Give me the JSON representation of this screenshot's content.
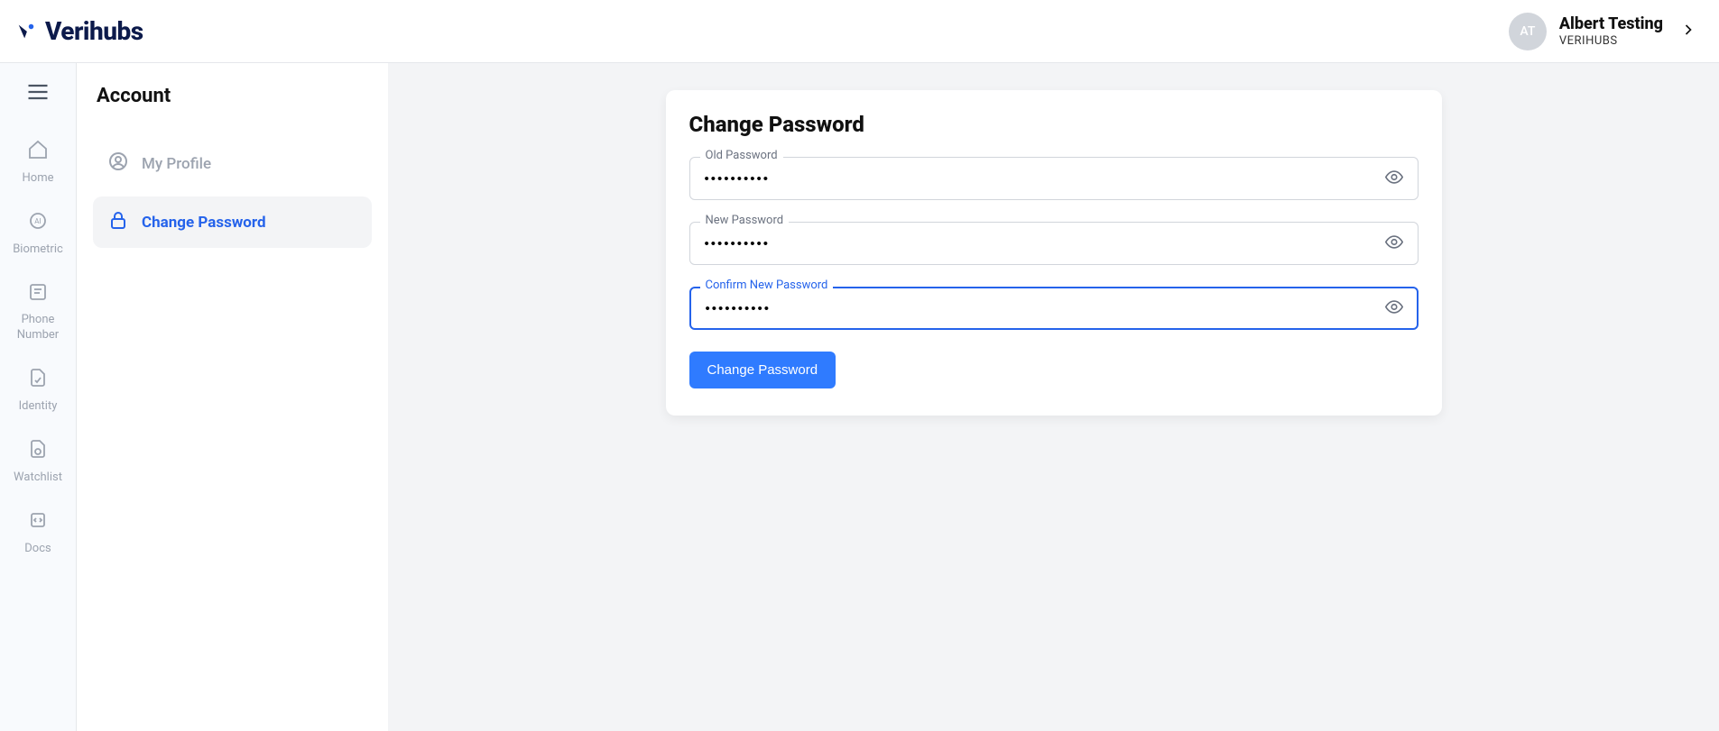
{
  "brand": "Verihubs",
  "user": {
    "initials": "AT",
    "name": "Albert Testing",
    "org": "VERIHUBS"
  },
  "leftrail": {
    "items": [
      {
        "label": "Home"
      },
      {
        "label": "Biometric"
      },
      {
        "label": "Phone Number"
      },
      {
        "label": "Identity"
      },
      {
        "label": "Watchlist"
      },
      {
        "label": "Docs"
      }
    ]
  },
  "account_sidebar": {
    "title": "Account",
    "items": [
      {
        "label": "My Profile",
        "active": false
      },
      {
        "label": "Change Password",
        "active": true
      }
    ]
  },
  "form": {
    "title": "Change Password",
    "fields": {
      "old": {
        "label": "Old Password",
        "value": "••••••••••"
      },
      "new": {
        "label": "New Password",
        "value": "••••••••••"
      },
      "confirm": {
        "label": "Confirm New Password",
        "value": "••••••••••"
      }
    },
    "submit_label": "Change Password"
  }
}
